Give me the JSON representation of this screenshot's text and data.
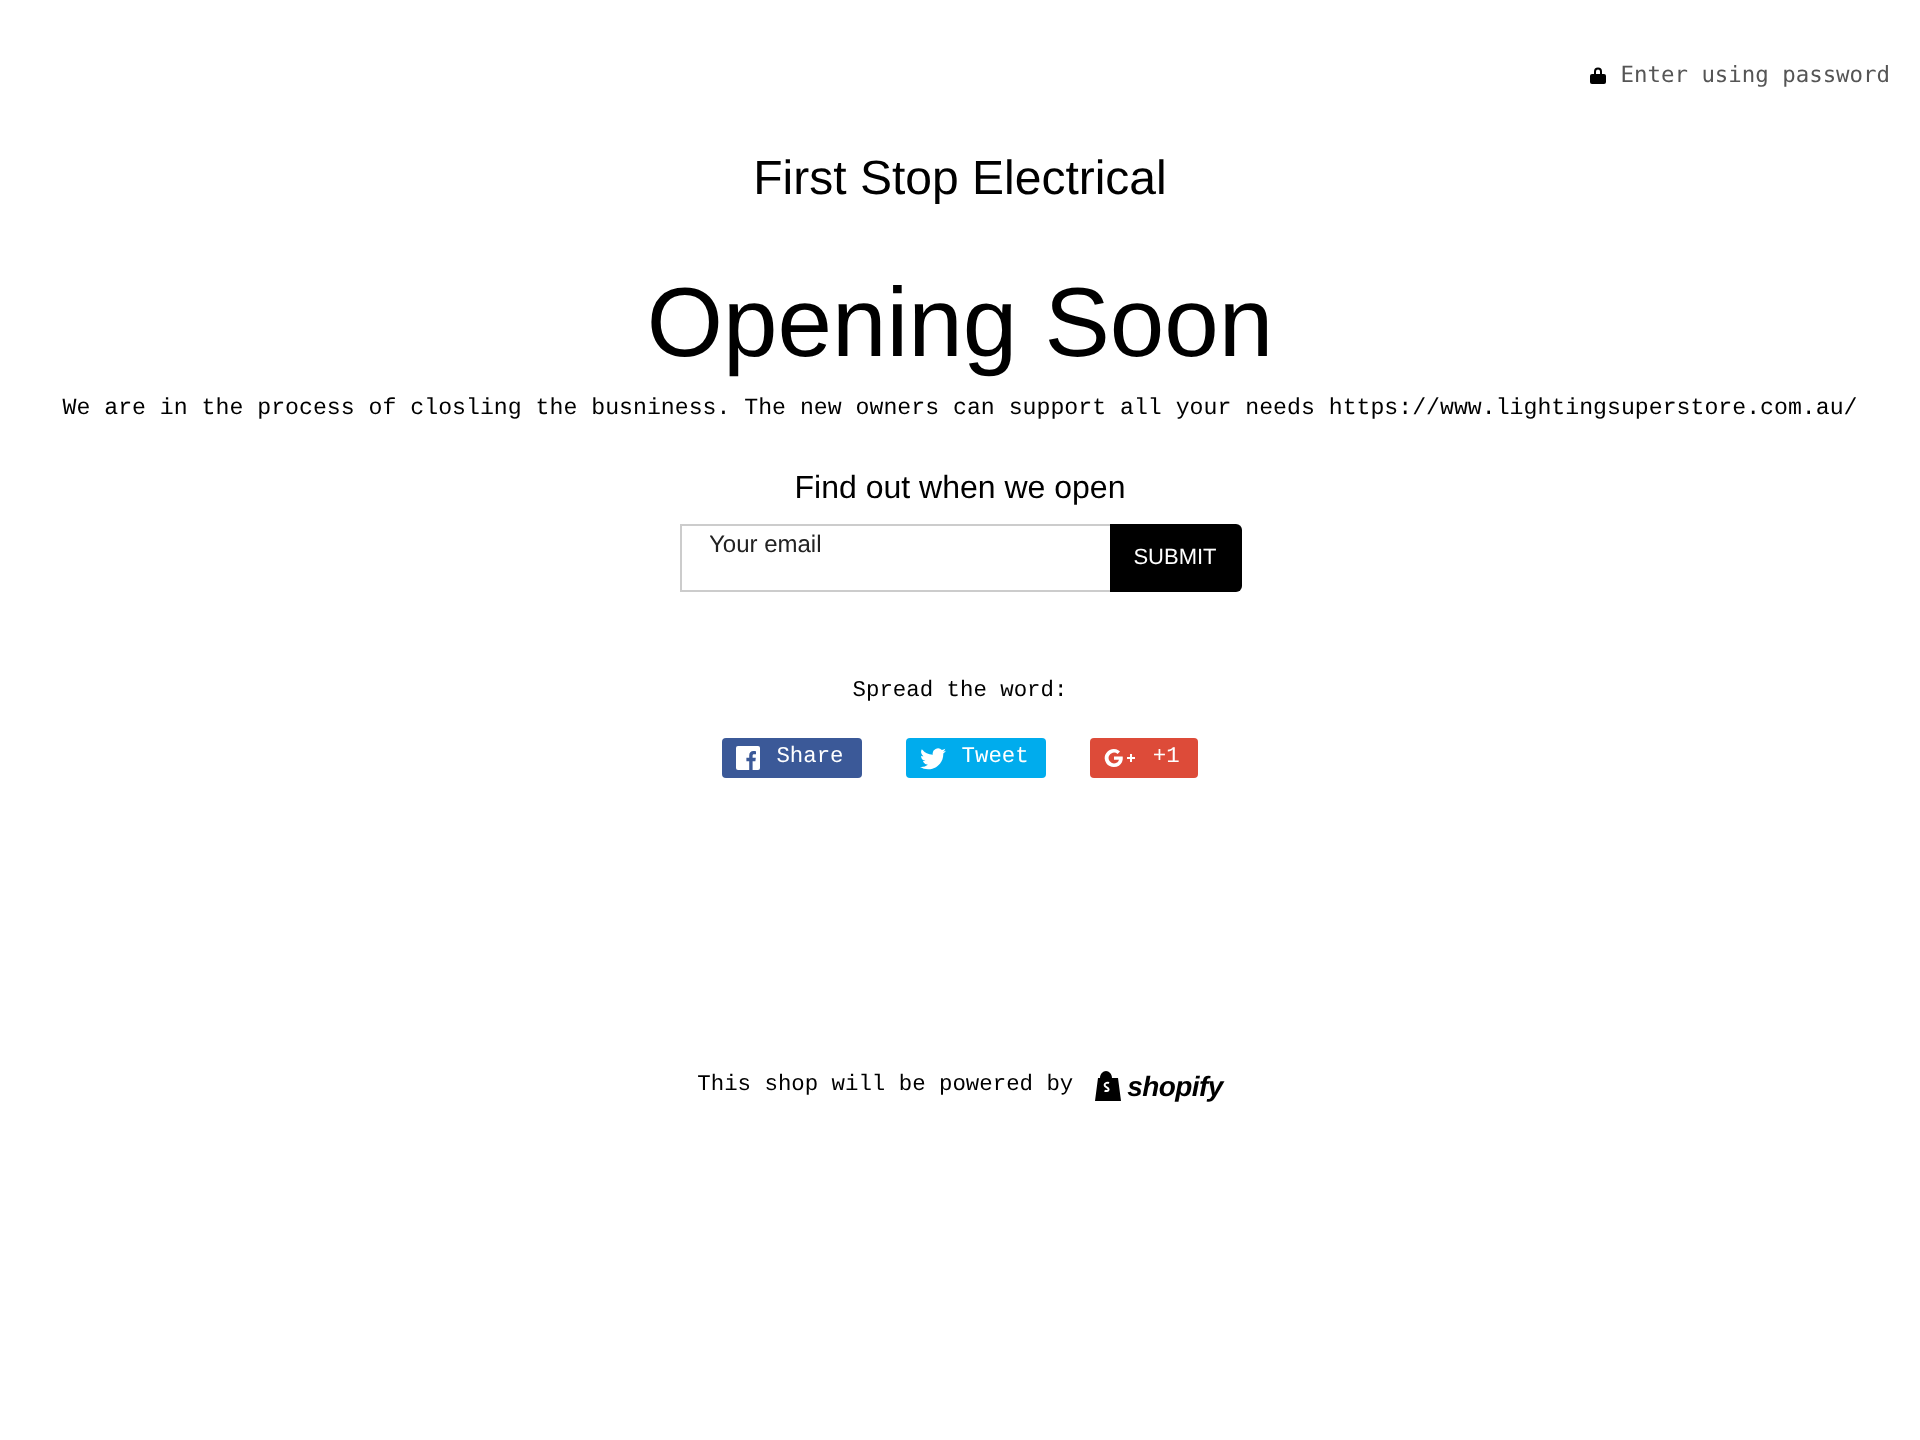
{
  "password_link": "Enter using password",
  "shop_name": "First Stop Electrical",
  "heading": "Opening Soon",
  "message": "We are in the process of closling the busniness. The new owners can support all your needs https://www.lightingsuperstore.com.au/",
  "signup": {
    "title": "Find out when we open",
    "placeholder": "Your email",
    "button": "SUBMIT"
  },
  "share": {
    "label": "Spread the word:",
    "buttons": [
      {
        "kind": "facebook",
        "label": "Share",
        "color": "#3b5998"
      },
      {
        "kind": "twitter",
        "label": "Tweet",
        "color": "#00aced"
      },
      {
        "kind": "google",
        "label": "+1",
        "color": "#dd4b39"
      }
    ]
  },
  "footer": {
    "text": "This shop will be powered by",
    "logo": "shopify"
  }
}
